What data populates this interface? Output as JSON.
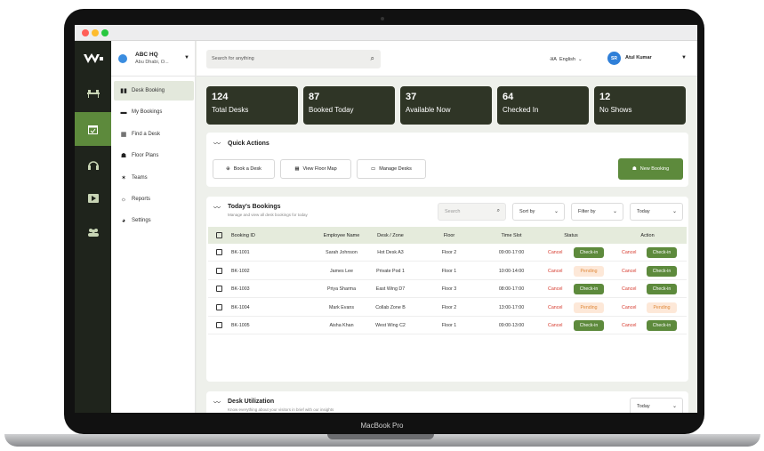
{
  "device": {
    "label": "MacBook Pro"
  },
  "org": {
    "name": "ABC HQ",
    "location": "Abu Dhabi, O..."
  },
  "sidebar": {
    "items": [
      {
        "label": "Desk Booking",
        "icon": "bar-chart-icon"
      },
      {
        "label": "My Bookings",
        "icon": "folder-icon"
      },
      {
        "label": "Find a Desk",
        "icon": "calendar-icon"
      },
      {
        "label": "Floor Plans",
        "icon": "user-plus-icon"
      },
      {
        "label": "Teams",
        "icon": "party-icon"
      },
      {
        "label": "Reports",
        "icon": "sun-icon"
      },
      {
        "label": "Settings",
        "icon": "pie-icon"
      }
    ]
  },
  "header": {
    "search_placeholder": "Search for anything",
    "language": "English",
    "user_initials": "SR",
    "user_name": "Atul Kumar"
  },
  "stats": [
    {
      "value": "124",
      "label": "Total Desks"
    },
    {
      "value": "87",
      "label": "Booked Today"
    },
    {
      "value": "37",
      "label": "Available Now"
    },
    {
      "value": "64",
      "label": "Checked In"
    },
    {
      "value": "12",
      "label": "No Shows"
    }
  ],
  "quick_actions": {
    "title": "Quick Actions",
    "buttons": [
      "Book a Desk",
      "View Floor Map",
      "Manage Desks"
    ],
    "primary": "New Booking"
  },
  "bookings": {
    "title": "Today's Bookings",
    "subtitle": "Manage and view all desk bookings for today",
    "search_placeholder": "Search",
    "sort_label": "Sort by",
    "filter_label": "Filter by",
    "date_label": "Today",
    "columns": [
      "Booking ID",
      "Employee Name",
      "Desk / Zone",
      "Floor",
      "Time Slot",
      "Status",
      "Action"
    ],
    "rows": [
      {
        "id": "BK-1001",
        "name": "Sarah Johnson",
        "desk": "Hot Desk A3",
        "floor": "Floor 2",
        "time": "09:00-17:00",
        "status_cancel": "Cancel",
        "status": "Check-in",
        "action_cancel": "Cancel",
        "action": "Check-in"
      },
      {
        "id": "BK-1002",
        "name": "James Lee",
        "desk": "Private Pod 1",
        "floor": "Floor 1",
        "time": "10:00-14:00",
        "status_cancel": "Cancel",
        "status": "Pending",
        "action_cancel": "Cancel",
        "action": "Check-in"
      },
      {
        "id": "BK-1003",
        "name": "Priya Sharma",
        "desk": "East Wing D7",
        "floor": "Floor 3",
        "time": "08:00-17:00",
        "status_cancel": "Cancel",
        "status": "Check-in",
        "action_cancel": "Cancel",
        "action": "Check-in"
      },
      {
        "id": "BK-1004",
        "name": "Mark Evans",
        "desk": "Collab Zone B",
        "floor": "Floor 2",
        "time": "13:00-17:00",
        "status_cancel": "Cancel",
        "status": "Pending",
        "action_cancel": "Cancel",
        "action": "Pending"
      },
      {
        "id": "BK-1005",
        "name": "Aisha Khan",
        "desk": "West Wing C2",
        "floor": "Floor 1",
        "time": "09:00-13:00",
        "status_cancel": "Cancel",
        "status": "Check-in",
        "action_cancel": "Cancel",
        "action": "Check-in"
      }
    ]
  },
  "utilization": {
    "title": "Desk Utilization",
    "subtitle": "Know everything about your visitors in brief with our insights",
    "date_label": "Today"
  }
}
